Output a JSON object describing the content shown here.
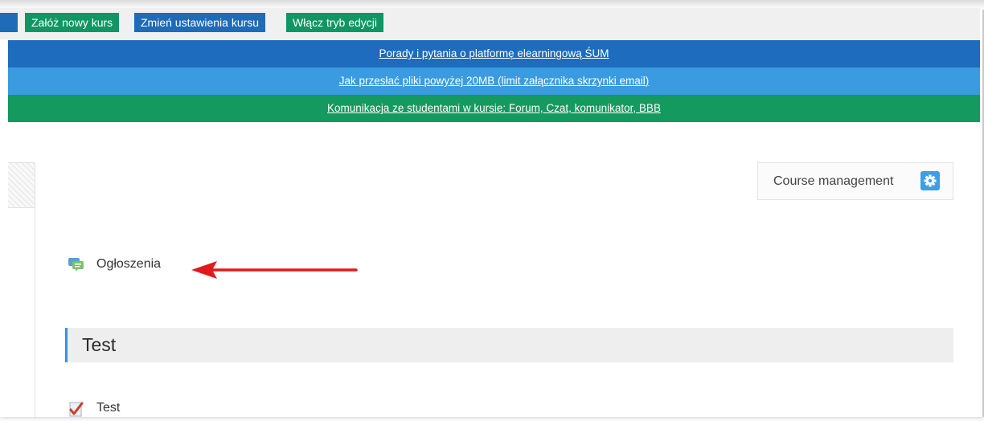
{
  "toolbar": {
    "buttons": [
      {
        "label": "Załóż nowy kurs"
      },
      {
        "label": "Zmień ustawienia kursu"
      },
      {
        "label": "Włącz tryb edycji"
      }
    ]
  },
  "info_links": [
    {
      "label": "Porady i pytania o platformę elearningową ŚUM"
    },
    {
      "label": "Jak przesłać pliki powyżej 20MB (limit załącznika skrzynki email)"
    },
    {
      "label": "Komunikacja ze studentami w kursie: Forum, Czat, komunikator, BBB"
    }
  ],
  "course_management": {
    "label": "Course management",
    "icon": "gear-icon"
  },
  "activities": [
    {
      "label": "Ogłoszenia",
      "icon": "forum-icon"
    },
    {
      "label": "Test",
      "icon": "quiz-icon"
    }
  ],
  "section": {
    "title": "Test"
  },
  "colors": {
    "green_button": "#109664",
    "blue_button": "#1e6bb8",
    "band_dark_blue": "#1d6cbd",
    "band_light_blue": "#3a9be0",
    "band_green": "#14995f",
    "arrow": "#e01b1b"
  }
}
